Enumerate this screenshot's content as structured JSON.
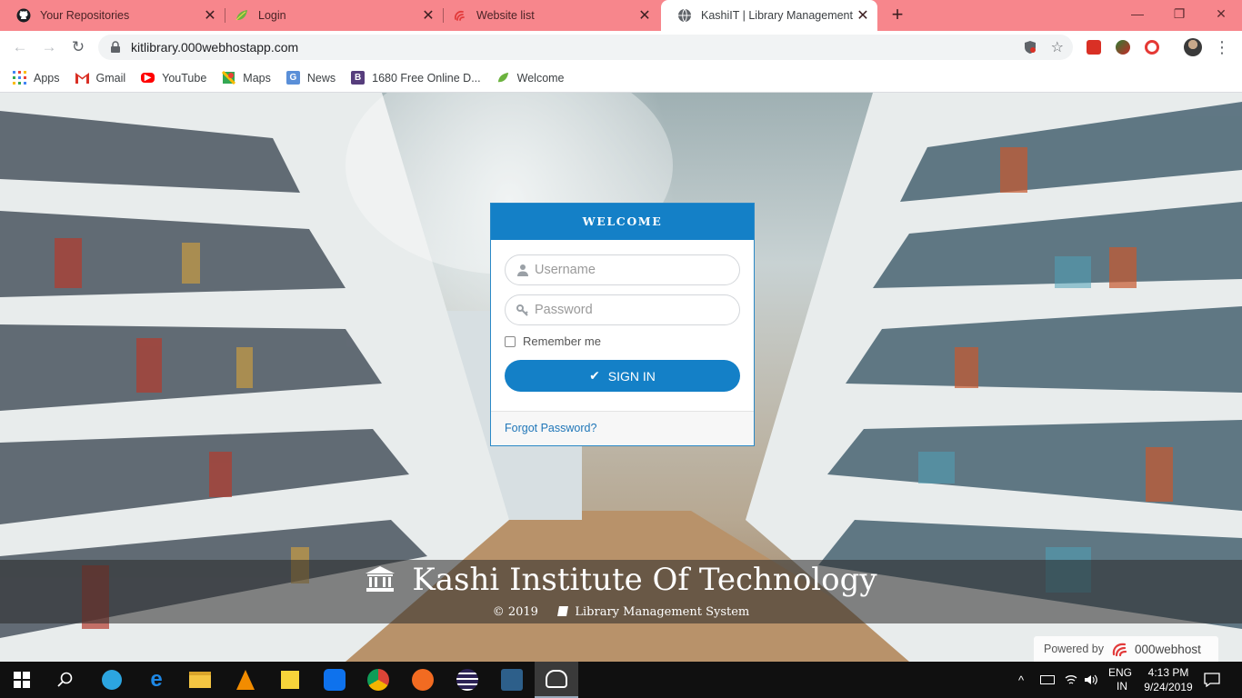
{
  "browser": {
    "tabs": [
      {
        "label": "Your Repositories",
        "icon": "github-icon"
      },
      {
        "label": "Login",
        "icon": "leaf-icon"
      },
      {
        "label": "Website list",
        "icon": "swirl-icon"
      },
      {
        "label": "KashiIT | Library Management Sy",
        "icon": "globe-icon"
      }
    ],
    "url": "kitlibrary.000webhostapp.com",
    "tab_color": "#f7868c",
    "bookmarks": [
      {
        "label": "Apps",
        "icon": "apps-grid-icon"
      },
      {
        "label": "Gmail",
        "icon": "gmail-icon"
      },
      {
        "label": "YouTube",
        "icon": "youtube-icon"
      },
      {
        "label": "Maps",
        "icon": "maps-icon"
      },
      {
        "label": "News",
        "icon": "news-icon"
      },
      {
        "label": "1680 Free Online D...",
        "icon": "bootstrap-icon"
      },
      {
        "label": "Welcome",
        "icon": "leaf-icon"
      }
    ]
  },
  "login": {
    "header": "WELCOME",
    "username_placeholder": "Username",
    "password_placeholder": "Password",
    "remember_label": "Remember me",
    "signin_label": "SIGN IN",
    "forgot_label": "Forgot Password?",
    "accent": "#1480c7"
  },
  "footer": {
    "institute": "Kashi Institute Of Technology",
    "copyright": "© 2019",
    "system": "Library Management System",
    "powered_label": "Powered by",
    "powered_brand": "000webhost"
  },
  "taskbar": {
    "lang_top": "ENG",
    "lang_bottom": "IN",
    "time": "4:13 PM",
    "date": "9/24/2019"
  }
}
